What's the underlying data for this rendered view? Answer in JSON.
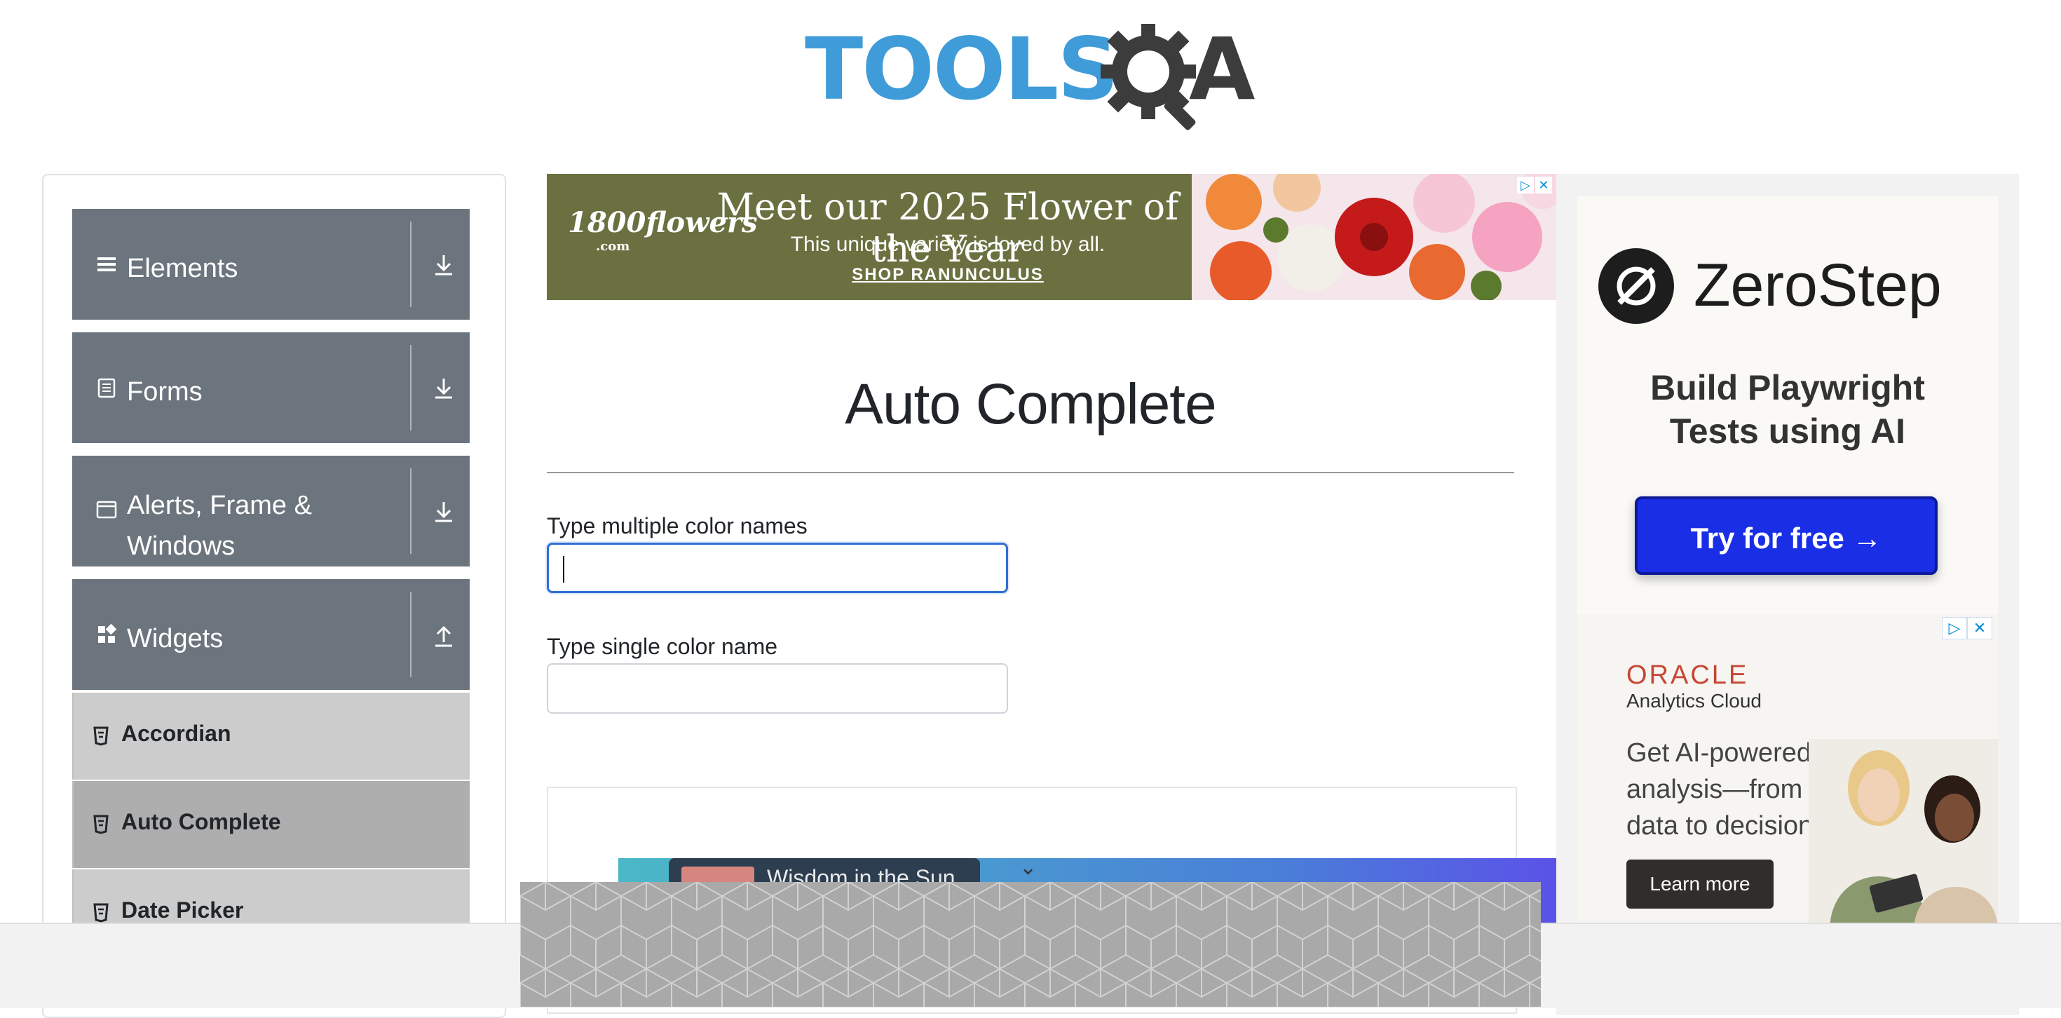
{
  "logo": {
    "text_tools": "TOOLS",
    "text_a": "A"
  },
  "sidebar": {
    "groups": [
      {
        "label": "Elements",
        "icon": "menu-icon",
        "toggle": "download-icon"
      },
      {
        "label": "Forms",
        "icon": "document-icon",
        "toggle": "download-icon"
      },
      {
        "label_line1": "Alerts, Frame &",
        "label_line2": "Windows",
        "icon": "window-icon",
        "toggle": "download-icon"
      },
      {
        "label": "Widgets",
        "icon": "widgets-icon",
        "toggle": "upload-icon"
      }
    ],
    "items": [
      {
        "label": "Accordian"
      },
      {
        "label": "Auto Complete",
        "active": true
      },
      {
        "label": "Date Picker"
      }
    ]
  },
  "ad_top": {
    "brand": "1800flowers",
    "brand_sub": ".com",
    "headline": "Meet our 2025 Flower of the Year",
    "subline": "This unique variety is loved by all.",
    "cta": "SHOP RANUNCULUS",
    "badge_play": "▷",
    "badge_close": "✕"
  },
  "main": {
    "title": "Auto Complete",
    "multi_label": "Type multiple color names",
    "multi_value": "",
    "single_label": "Type single color name",
    "single_value": ""
  },
  "video_ad": {
    "title": "Wisdom in the Sun",
    "chevron": "⌄"
  },
  "right_ads": {
    "zerostep": {
      "name": "ZeroStep",
      "line1": "Build Playwright",
      "line2": "Tests using AI",
      "button": "Try for free →"
    },
    "oracle": {
      "brand": "ORACLE",
      "sub": "Analytics Cloud",
      "text": "Get AI-powered analysis—from data to decision",
      "button": "Learn more",
      "badge_play": "▷",
      "badge_close": "✕"
    }
  },
  "colors": {
    "sidebar_group": "#6c757d",
    "sidebar_item": "#cccccc",
    "sidebar_item_active": "#aeaeae",
    "focus": "#2f6fd6",
    "logo_blue": "#3f9cd8",
    "zerostep_button": "#1a2ee6",
    "oracle_red": "#c74634"
  }
}
